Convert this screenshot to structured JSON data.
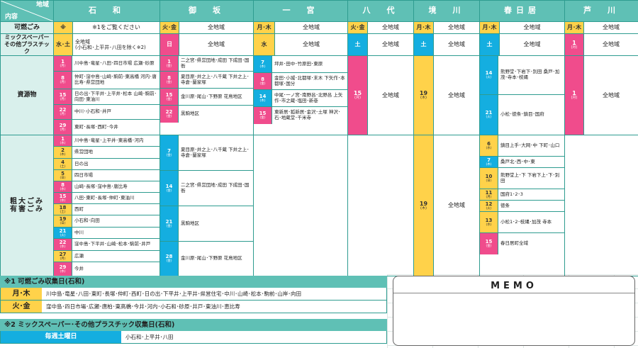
{
  "header": {
    "corner_top": "地域",
    "corner_bottom": "内容",
    "districts": [
      "石　和",
      "御　坂",
      "一　宮",
      "八　代",
      "境　川",
      "春日居",
      "芦　川"
    ]
  },
  "rows": {
    "burnable": {
      "label": "可燃ごみ",
      "isawa_day": "※",
      "isawa_text": "※1をご覧ください",
      "misaka_day": "火･金",
      "misaka_area": "全地域",
      "ichinomiya_day": "月･木",
      "ichinomiya_area": "全地域",
      "yatsushiro_day": "火･金",
      "yatsushiro_area": "全地域",
      "sakaigawa_day": "月･木",
      "sakaigawa_area": "全地域",
      "kasugai_day": "月･木",
      "kasugai_area": "全地域",
      "ashigawa_day": "月･木",
      "ashigawa_area": "全地域"
    },
    "mixed_paper": {
      "label_1": "ミックスペーパー",
      "label_2": "その他プラスチック",
      "isawa_day": "水･土",
      "isawa_text_1": "全地域",
      "isawa_text_2": "(小石和･上平井･八田を除く※2)",
      "misaka_day": "日",
      "misaka_area": "全地域",
      "ichinomiya_day": "水",
      "ichinomiya_area": "全地域",
      "yatsushiro_day": "土",
      "yatsushiro_area": "全地域",
      "sakaigawa_day": "土",
      "sakaigawa_area": "全地域",
      "kasugai_day": "土",
      "kasugai_area": "全地域",
      "ashigawa_day": "1",
      "ashigawa_wk": "(月)",
      "ashigawa_area": "全地域"
    },
    "resources": {
      "label": "資源物",
      "isawa": [
        {
          "d": "1",
          "w": "(月)",
          "t": "川中島･竜星･八田･四日市場 広瀬･砂原"
        },
        {
          "d": "8",
          "w": "(月)",
          "t": "仲町･窪中島･山崎･駒前･東高橋 河内･唐比寿･県営団地"
        },
        {
          "d": "15",
          "w": "(月)",
          "t": "日の出･下平井･上平井･松本 山崎･駒前･向田･東油川"
        },
        {
          "d": "22",
          "w": "(月)",
          "t": "中川･小石和･井戸"
        },
        {
          "d": "29",
          "w": "(月)",
          "t": "東町･長塚･西町･今井"
        }
      ],
      "misaka": [
        {
          "d": "1",
          "w": "(金)",
          "t": "二之宮･県営団地･成田 下成田･国衙"
        },
        {
          "d": "8",
          "w": "(金)",
          "t": "夏目原･井之上･八千蔵 下井之上･寺倉･蘭家塚"
        },
        {
          "d": "15",
          "w": "(金)",
          "t": "金川原･尾山･下野原 花鳥地区"
        },
        {
          "d": "22",
          "w": "(金)",
          "t": "黒駒地区"
        }
      ],
      "ichinomiya": [
        {
          "d": "7",
          "w": "(木)",
          "t": "坪井･田中･竹原田･東原"
        },
        {
          "d": "8",
          "w": "(金)",
          "t": "金田･小城･北都塚･末木 下矢作･本都塚･国分"
        },
        {
          "d": "14",
          "w": "(木)",
          "t": "中尾･一ノ宮･南野呂･北野呂 上矢作･市之蔵･塩田･新巻"
        },
        {
          "d": "15",
          "w": "(金)",
          "t": "東新居･狐新居･金沢･土塚 神沢･石･地蔵堂･千米寺"
        }
      ],
      "yatsushiro": {
        "d": "15",
        "w": "(月)",
        "area": "全地域"
      },
      "sakaigawa": {
        "d": "19",
        "w": "(木)",
        "area": "全地域"
      },
      "kasugai": [
        {
          "d": "14",
          "w": "(火)",
          "t": "熊野堂･下岩下･別田 桑戸･加茂･寺本･枝縄"
        },
        {
          "d": "21",
          "w": "(火)",
          "t": "小松･徳条･鎮目･国府"
        }
      ],
      "ashigawa": {
        "d": "1",
        "w": "(月)",
        "area": "全地域"
      }
    },
    "bulky": {
      "label_1": "粗大ごみ",
      "label_2": "有害ごみ",
      "isawa": [
        {
          "d": "1",
          "w": "(水)",
          "t": "川中島･竜星･上平井･東高橋･河内",
          "c": "pnk"
        },
        {
          "d": "2",
          "w": "(木)",
          "t": "県営団地",
          "c": "yel"
        },
        {
          "d": "4",
          "w": "(土)",
          "t": "日の出",
          "c": "yel"
        },
        {
          "d": "5",
          "w": "(日)",
          "t": "四日市場",
          "c": "yel"
        },
        {
          "d": "8",
          "w": "(水)",
          "t": "山崎･長塚･窪中島･唐比寿",
          "c": "pnk"
        },
        {
          "d": "15",
          "w": "(水)",
          "t": "八田･東町･長塚･仲町･東油川",
          "c": "pnk"
        },
        {
          "d": "18",
          "w": "(土)",
          "t": "西町",
          "c": "yel"
        },
        {
          "d": "19",
          "w": "(日)",
          "t": "小石和･向田",
          "c": "yel"
        },
        {
          "d": "21",
          "w": "(火)",
          "t": "中川",
          "c": "blu"
        },
        {
          "d": "22",
          "w": "(水)",
          "t": "窪中島･下平井･山崎･松本･駒前･井戸",
          "c": "pnk"
        },
        {
          "d": "27",
          "w": "(月)",
          "t": "広瀬",
          "c": "yel"
        },
        {
          "d": "29",
          "w": "(水)",
          "t": "今井",
          "c": "pnk"
        }
      ],
      "misaka": [
        {
          "d": "7",
          "w": "(金)",
          "t": "夏目原･井之上･八千蔵 下井之上･寺倉･蘭家塚"
        },
        {
          "d": "14",
          "w": "(金)",
          "t": "二之宮･県営団地･成田 下成田･国衙"
        },
        {
          "d": "21",
          "w": "(金)",
          "t": "黒駒地区"
        },
        {
          "d": "28",
          "w": "(金)",
          "t": "金川原･尾山･下野原 花鳥地区"
        }
      ],
      "sakaigawa": {
        "d": "19",
        "w": "(木)",
        "area": "全地域"
      },
      "kasugai": [
        {
          "d": "6",
          "w": "(水)",
          "t": "鎮目上手･大网･中 下町･山口",
          "c": "yel"
        },
        {
          "d": "7",
          "w": "(木)",
          "t": "桑戸北･西･中･東",
          "c": "blu"
        },
        {
          "d": "10",
          "w": "(日)",
          "t": "熊野堂上･下 下岩下上･下･別田",
          "c": "yel"
        },
        {
          "d": "11",
          "w": "(月)",
          "t": "国府1･2･3",
          "c": "yel"
        },
        {
          "d": "12",
          "w": "(火)",
          "t": "徳条",
          "c": "yel"
        },
        {
          "d": "13",
          "w": "(水)",
          "t": "小松1･2･枝縄･加茂 寺本",
          "c": "yel"
        },
        {
          "d": "15",
          "w": "(金)",
          "t": "春日居町全域",
          "c": "pnk"
        }
      ]
    }
  },
  "legend": {
    "note1_title": "※1 可燃ごみ収集日(石和)",
    "note1_rows": [
      {
        "k": "月･木",
        "v": "川中島･竜星･八田･東町･長塚･仲町･西町･日の出･下平井･上平井･県営住宅･中川･山崎･松本･駒前･山岸･向田"
      },
      {
        "k": "火･金",
        "v": "窪中島･四日市場･広瀬･唐柏･東高橋･今井･河内･小石和･砂原･井戸･東油川･恵比寿"
      }
    ],
    "note2_title": "※2 ミックスペーパー･その他プラスチック収集日(石和)",
    "note2_row": {
      "k": "毎週土曜日",
      "v": "小石和･上平井･八田"
    }
  },
  "memo": {
    "title": "MEMO"
  },
  "colors": {
    "header": "#5fc0b5",
    "yellow": "#ffd24a",
    "blue": "#14aee0",
    "pink": "#f04c8c"
  }
}
